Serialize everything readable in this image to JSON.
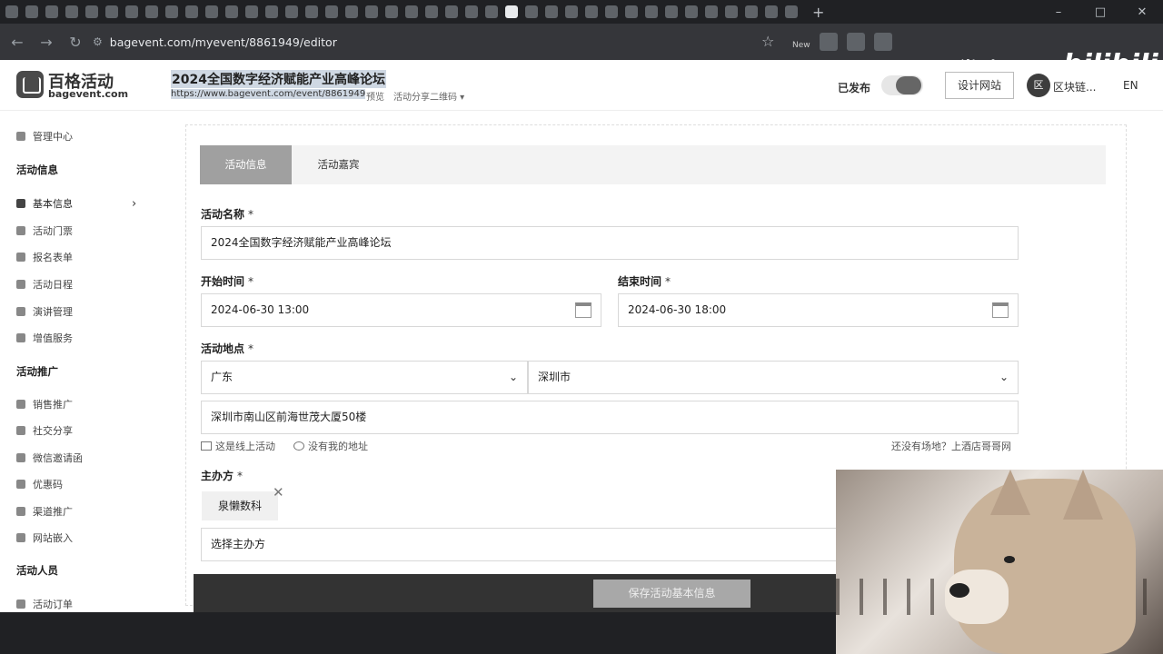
{
  "browser": {
    "url": "bagevent.com/myevent/8861949/editor",
    "watermark_cn": "赏味不足",
    "watermark_brand": "bilibili",
    "new_badge": "New"
  },
  "header": {
    "logo_cn": "百格活动",
    "logo_en": "bagevent.com",
    "event_title": "2024全国数字经济赋能产业高峰论坛",
    "event_url": "https://www.bagevent.com/event/8861949",
    "preview": "预览",
    "share_qr": "活动分享二维码 ▾",
    "published": "已发布",
    "design_site": "设计网站",
    "org_avatar": "区",
    "org_name": "区块链...",
    "lang": "EN"
  },
  "sidebar": {
    "top": "管理中心",
    "group1": "活动信息",
    "items1": [
      "基本信息",
      "活动门票",
      "报名表单",
      "活动日程",
      "演讲管理",
      "增值服务"
    ],
    "group2": "活动推广",
    "items2": [
      "销售推广",
      "社交分享",
      "微信邀请函",
      "优惠码",
      "渠道推广",
      "网站嵌入"
    ],
    "group3": "活动人员",
    "items3": [
      "活动订单"
    ]
  },
  "tabs": {
    "active": "活动信息",
    "inactive": "活动嘉宾"
  },
  "form": {
    "name_label": "活动名称",
    "name_value": "2024全国数字经济赋能产业高峰论坛",
    "start_label": "开始时间",
    "start_value": "2024-06-30 13:00",
    "end_label": "结束时间",
    "end_value": "2024-06-30 18:00",
    "location_label": "活动地点",
    "province": "广东",
    "city": "深圳市",
    "address": "深圳市南山区前海世茂大厦50楼",
    "online_link": "这是线上活动",
    "no_address_link": "没有我的地址",
    "venue_hint": "还没有场地？上酒店哥哥网",
    "host_label": "主办方",
    "host_tag": "泉懒数科",
    "host_placeholder": "选择主办方",
    "required_mark": "*",
    "save_button": "保存活动基本信息"
  }
}
